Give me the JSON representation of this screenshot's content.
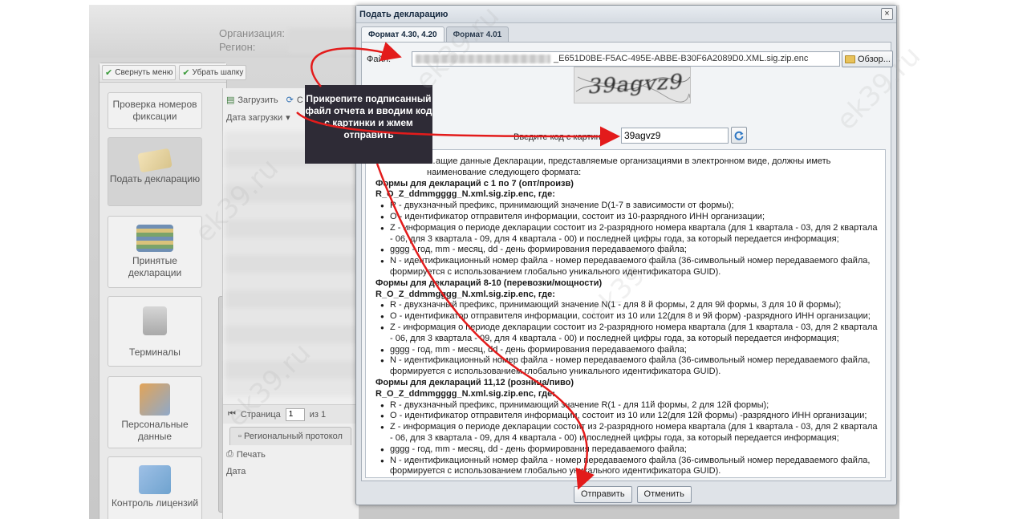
{
  "app": {
    "org_label": "Организация:",
    "region_label": "Регион:",
    "toolbar": {
      "collapse_menu": "Свернуть меню",
      "hide_header": "Убрать шапку"
    },
    "nav": [
      {
        "label": "Проверка номеров фиксации"
      },
      {
        "label": "Подать декларацию"
      },
      {
        "label": "Принятые декларации"
      },
      {
        "label": "Терминалы"
      },
      {
        "label": "Персональные данные"
      },
      {
        "label": "Контроль лицензий"
      }
    ],
    "mid": {
      "upload_btn": "Загрузить",
      "partial_btn": "С",
      "col_date": "Дата загрузки",
      "pager_page_label": "Страница",
      "pager_page_value": "1",
      "pager_of": "из 1",
      "tab_regional": "Региональный протокол",
      "print_btn": "Печать",
      "col_date2": "Дата"
    }
  },
  "dialog": {
    "title": "Подать декларацию",
    "close": "×",
    "tabs": [
      {
        "label": "Формат 4.30, 4.20"
      },
      {
        "label": "Формат 4.01"
      }
    ],
    "file_label": "Файл:",
    "file_value": "_E651D0BE-F5AC-495E-ABBE-B30F6A2089D0.XML.sig.zip.enc",
    "browse_btn": "Обзор...",
    "captcha_text": "39agvz9",
    "code_label": "Введите код с картинки:",
    "code_value": "39agvz9",
    "info": {
      "intro": "…ащие данные Декларации, представляемые организациями в электронном виде, должны иметь наименование следующего формата:",
      "sec1_title": "Формы для деклараций с 1 по 7 (опт/произв)",
      "sec1_pattern": "R_O_Z_ddmmgggg_N.xml.sig.zip.enc, где:",
      "sec1_items": [
        "R - двухзначный префикс, принимающий значение D(1-7 в зависимости от формы);",
        "O - идентификатор отправителя информации, состоит из 10-разрядного ИНН организации;",
        "Z - информация о периоде декларации состоит из 2-разрядного номера квартала (для 1 квартала - 03, для 2 квартала - 06, для 3 квартала - 09, для 4 квартала - 00) и последней цифры года, за который передается информация;",
        "gggg - год, mm - месяц, dd - день формирования передаваемого файла;",
        "N - идентификационный номер файла - номер передаваемого файла (36-символьный номер передаваемого файла, формируется с использованием глобально уникального идентификатора GUID)."
      ],
      "sec2_title": "Формы для деклараций 8-10 (перевозки/мощности)",
      "sec2_pattern": "R_O_Z_ddmmgggg_N.xml.sig.zip.enc, где:",
      "sec2_items": [
        "R - двухзначный префикс, принимающий значение N(1 - для 8 й формы, 2 для 9й формы, 3 для 10 й формы);",
        "O - идентификатор отправителя информации, состоит из 10 или 12(для 8 и 9й форм) -разрядного ИНН организации;",
        "Z - информация о периоде декларации состоит из 2-разрядного номера квартала (для 1 квартала - 03, для 2 квартала - 06, для 3 квартала - 09, для 4 квартала - 00) и последней цифры года, за который передается информация;",
        "gggg - год, mm - месяц, dd - день формирования передаваемого файла;",
        "N - идентификационный номер файла - номер передаваемого файла (36-символьный номер передаваемого файла, формируется с использованием глобально уникального идентификатора GUID)."
      ],
      "sec3_title": "Формы для деклараций 11,12 (розница/пиво)",
      "sec3_pattern": "R_O_Z_ddmmgggg_N.xml.sig.zip.enc, где:",
      "sec3_items": [
        "R - двухзначный префикс, принимающий значение R(1 - для 11й формы, 2 для 12й формы);",
        "O - идентификатор отправителя информации, состоит из 10 или 12(для 12й формы) -разрядного ИНН организации;",
        "Z - информация о периоде декларации состоит из 2-разрядного номера квартала (для 1 квартала - 03, для 2 квартала - 06, для 3 квартала - 09, для 4 квартала - 00) и последней цифры года, за который передается информация;",
        "gggg - год, mm - месяц, dd - день формирования передаваемого файла;",
        "N - идентификационный номер файла - номер передаваемого файла (36-символьный номер передаваемого файла, формируется с использованием глобально уникального идентификатора GUID)."
      ]
    },
    "submit_btn": "Отправить",
    "cancel_btn": "Отменить"
  },
  "callout": {
    "text": "Прикрепите подписанный файл отчета и вводим код с картинки и жмем отправить"
  },
  "colors": {
    "arrow": "#e31b1b",
    "callout_bg": "#2e2b36",
    "dialog_title": "#15293f"
  },
  "watermark": "ek39.ru"
}
